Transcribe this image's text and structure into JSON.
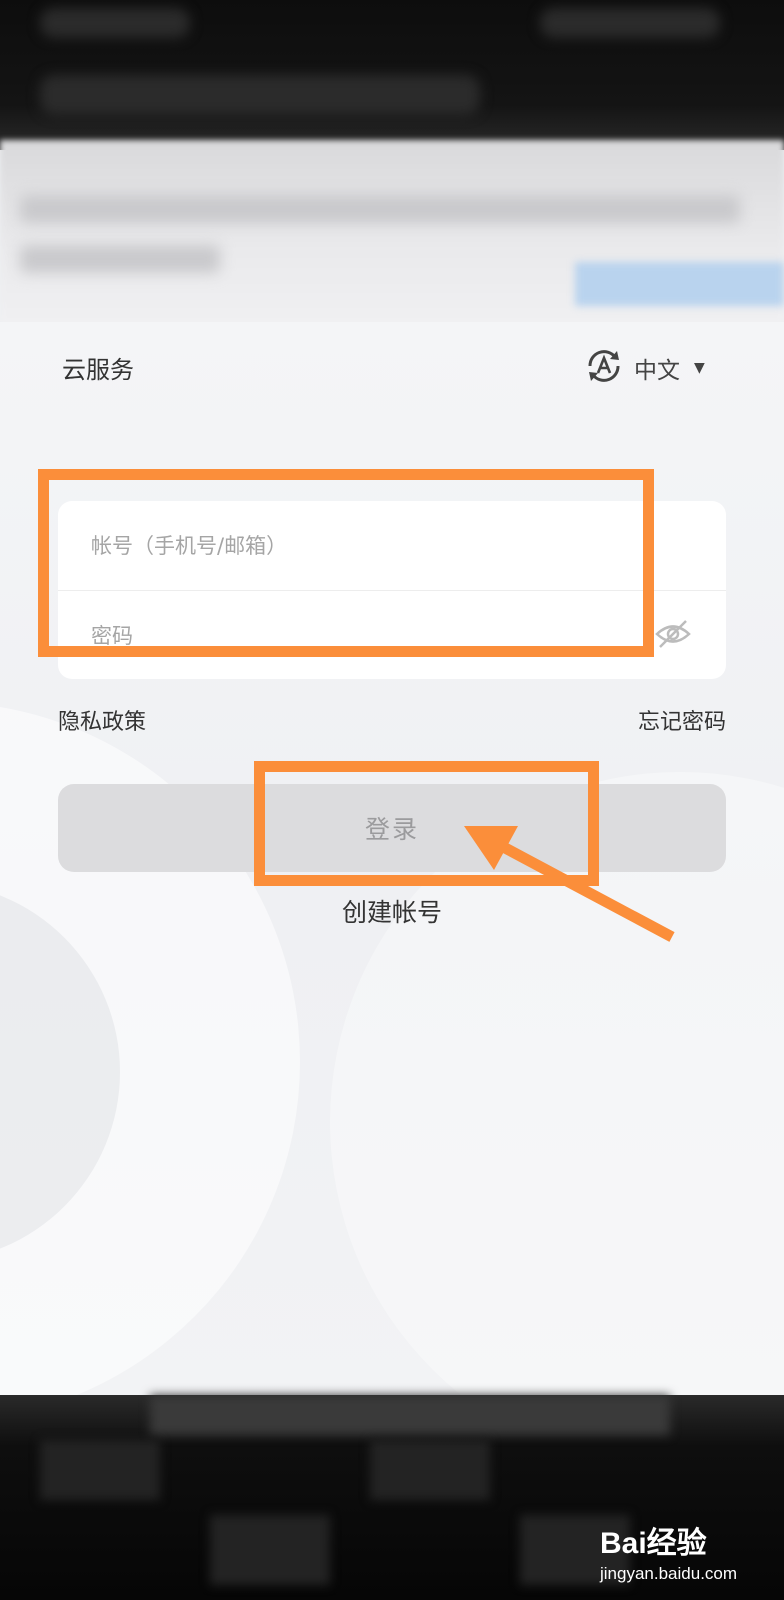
{
  "header": {
    "title": "云服务",
    "language": "中文"
  },
  "login_form": {
    "account_placeholder": "帐号（手机号/邮箱）",
    "password_placeholder": "密码"
  },
  "links": {
    "privacy": "隐私政策",
    "forgot_password": "忘记密码"
  },
  "buttons": {
    "login": "登录",
    "create_account": "创建帐号"
  },
  "watermark": {
    "logo_text": "Bai经验",
    "url": "jingyan.baidu.com"
  },
  "icons": {
    "language": "language-a-refresh-icon",
    "dropdown": "caret-down-icon",
    "password_visibility": "eye-off-icon",
    "annotation_arrow": "arrow-icon"
  },
  "colors": {
    "annotation": "#fb8e3a",
    "login_button_bg": "#dcdcde",
    "card_bg": "#ffffff"
  }
}
